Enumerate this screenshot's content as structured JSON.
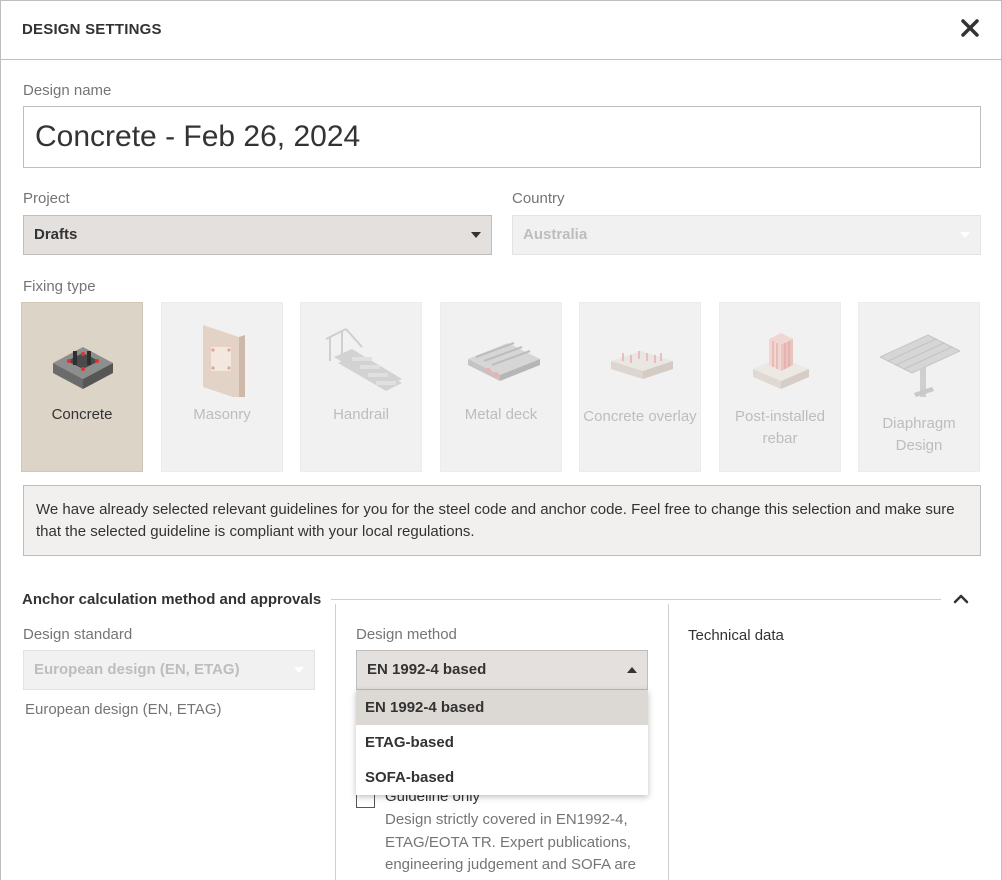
{
  "dialog": {
    "title": "DESIGN SETTINGS",
    "close_icon": "close-icon"
  },
  "design_name": {
    "label": "Design name",
    "value": "Concrete - Feb 26, 2024"
  },
  "project": {
    "label": "Project",
    "value": "Drafts"
  },
  "country": {
    "label": "Country",
    "value": "Australia"
  },
  "fixing_type": {
    "label": "Fixing type",
    "tiles": [
      {
        "label": "Concrete",
        "icon": "concrete-base-icon",
        "active": true
      },
      {
        "label": "Masonry",
        "icon": "masonry-wall-icon",
        "active": false
      },
      {
        "label": "Handrail",
        "icon": "handrail-stairs-icon",
        "active": false
      },
      {
        "label": "Metal deck",
        "icon": "metal-deck-icon",
        "active": false
      },
      {
        "label": "Concrete overlay",
        "icon": "concrete-overlay-icon",
        "active": false
      },
      {
        "label": "Post-installed rebar",
        "icon": "post-installed-rebar-icon",
        "active": false
      },
      {
        "label": "Diaphragm Design",
        "icon": "diaphragm-deck-icon",
        "active": false
      }
    ]
  },
  "info_text": "We have already selected relevant guidelines for you for the steel code and anchor code. Feel free to change this selection and make sure that the selected guideline is compliant with your local regulations.",
  "anchor_section": {
    "title": "Anchor calculation method and approvals",
    "design_standard": {
      "label": "Design standard",
      "value": "European design (EN, ETAG)",
      "description": "European design (EN, ETAG)"
    },
    "design_method": {
      "label": "Design method",
      "value": "EN 1992-4 based",
      "options": [
        "EN 1992-4 based",
        "ETAG-based",
        "SOFA-based"
      ]
    },
    "guideline": {
      "label": "Guideline only",
      "checked": false,
      "description": "Design strictly covered in EN1992-4, ETAG/EOTA TR. Expert publications, engineering judgement and SOFA are"
    },
    "technical_data_label": "Technical data"
  },
  "colors": {
    "active_tile": "#dcd4c7",
    "select_bg": "#e3e0dd",
    "muted_text": "#757575",
    "disabled_text": "#bdbdbd"
  }
}
